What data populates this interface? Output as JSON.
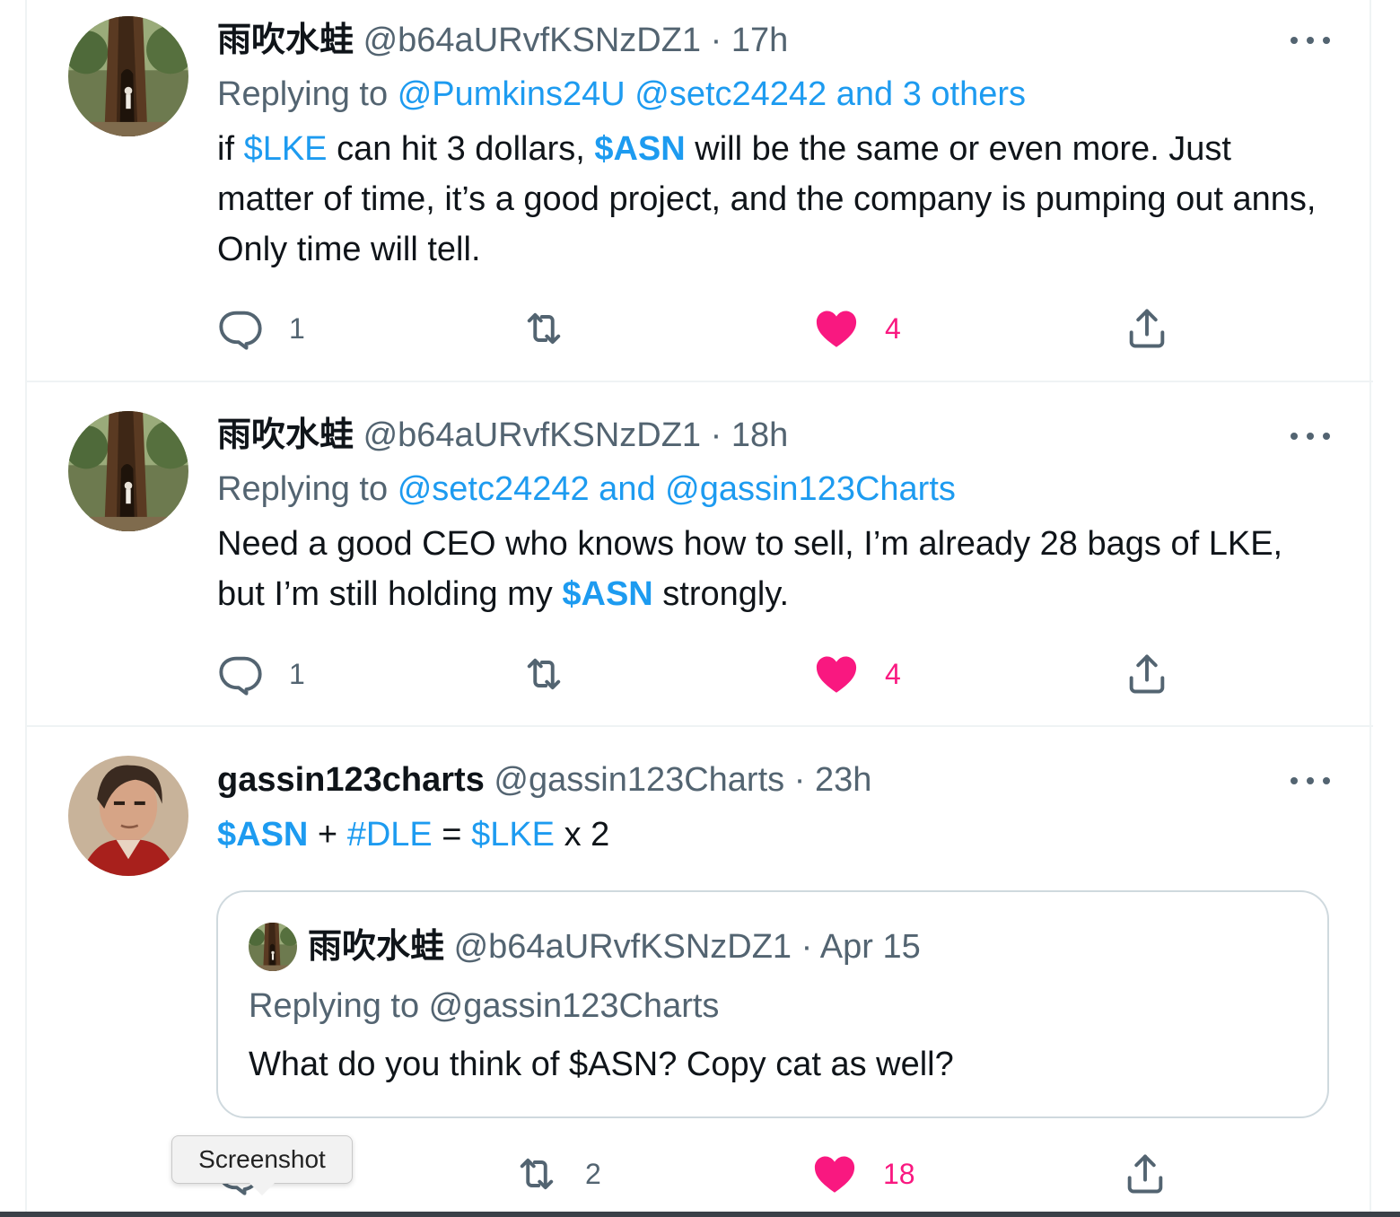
{
  "tweets": [
    {
      "name": "雨吹水蛙",
      "handle": "@b64aURvfKSNzDZ1",
      "dot": "·",
      "time": "17h",
      "replying_prefix": "Replying to",
      "replying_links": "@Pumkins24U @setc24242 and 3 others",
      "body": {
        "p1": "if ",
        "l1": "$LKE",
        "p2": " can hit 3 dollars, ",
        "l2": "$ASN",
        "p3": " will be the same or even more. Just matter of time, it’s a good project, and the company is pumping out anns, Only time will tell."
      },
      "replies": "1",
      "retweets": "",
      "likes": "4",
      "avatar_icon": "tree-avatar"
    },
    {
      "name": "雨吹水蛙",
      "handle": "@b64aURvfKSNzDZ1",
      "dot": "·",
      "time": "18h",
      "replying_prefix": "Replying to",
      "replying_links": "@setc24242 and @gassin123Charts",
      "body": {
        "p1": "Need a good CEO who knows how to sell, I’m already 28 bags of LKE, but I’m still holding my ",
        "l1": "$ASN",
        "p2": " strongly."
      },
      "replies": "1",
      "retweets": "",
      "likes": "4",
      "avatar_icon": "tree-avatar"
    },
    {
      "name": "gassin123charts",
      "handle": "@gassin123Charts",
      "dot": "·",
      "time": "23h",
      "body": {
        "l1": "$ASN",
        "p1": " + ",
        "l2": "#DLE",
        "p2": " = ",
        "l3": "$LKE",
        "p3": " x 2"
      },
      "quote": {
        "name": "雨吹水蛙",
        "handle": "@b64aURvfKSNzDZ1",
        "dot": "·",
        "date": "Apr 15",
        "replying": "Replying to @gassin123Charts",
        "text": "What do you think of $ASN? Copy cat as well?"
      },
      "replies": "",
      "retweets": "2",
      "likes": "18",
      "avatar_icon": "person-avatar"
    }
  ],
  "tooltip": "Screenshot",
  "colors": {
    "link": "#1d9bf0",
    "like": "#f91880",
    "muted": "#536471",
    "text": "#0f1419",
    "border": "#eff3f4"
  }
}
